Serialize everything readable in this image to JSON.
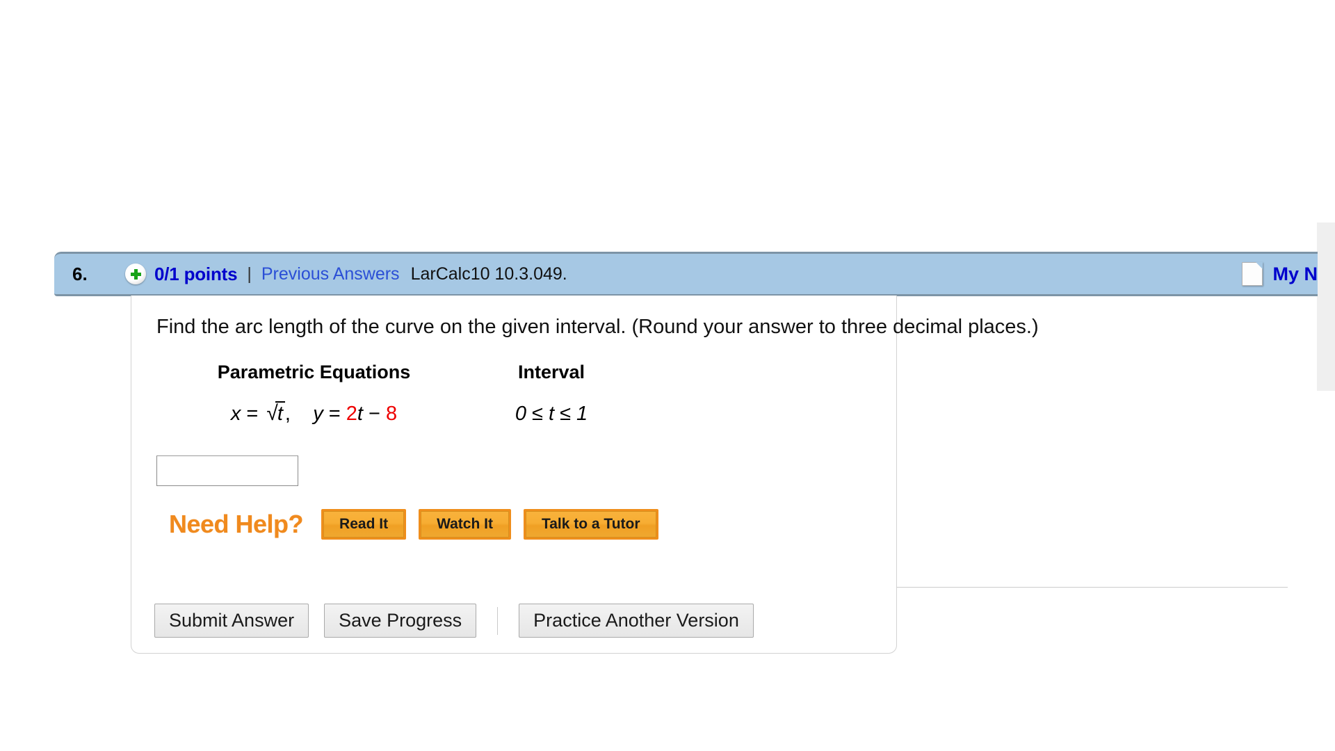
{
  "question": {
    "number": "6.",
    "status_icon": "plus-circle-icon",
    "points": "0/1 points",
    "separator": "|",
    "previous_answers_label": "Previous Answers",
    "code": "LarCalc10 10.3.049.",
    "notes_icon": "note-page-icon",
    "notes_label": "My N",
    "prompt": "Find the arc length of the curve on the given interval. (Round your answer to three decimal places.)"
  },
  "math": {
    "header_parametric": "Parametric Equations",
    "header_interval": "Interval",
    "x_label": "x",
    "equals": "=",
    "radical_glyph": "√",
    "x_radicand": "t",
    "x_comma": ",",
    "y_label": "y",
    "y_coefficient": "2",
    "y_variable": "t",
    "y_minus": "−",
    "y_constant": "8",
    "interval": "0 ≤ t ≤ 1"
  },
  "answer": {
    "value": "",
    "placeholder": ""
  },
  "help": {
    "title": "Need Help?",
    "buttons": [
      {
        "label": "Read It"
      },
      {
        "label": "Watch It"
      },
      {
        "label": "Talk to a Tutor"
      }
    ]
  },
  "actions": {
    "submit_label": "Submit Answer",
    "save_label": "Save Progress",
    "practice_label": "Practice Another Version"
  },
  "colors": {
    "header_bar": "#a6c8e4",
    "header_border": "#7d94a6",
    "points_text": "#0000cc",
    "link_text": "#2b4fd6",
    "highlight_red": "#ee0000",
    "help_orange": "#f08a1e",
    "button_face": "#e6e6e6"
  }
}
